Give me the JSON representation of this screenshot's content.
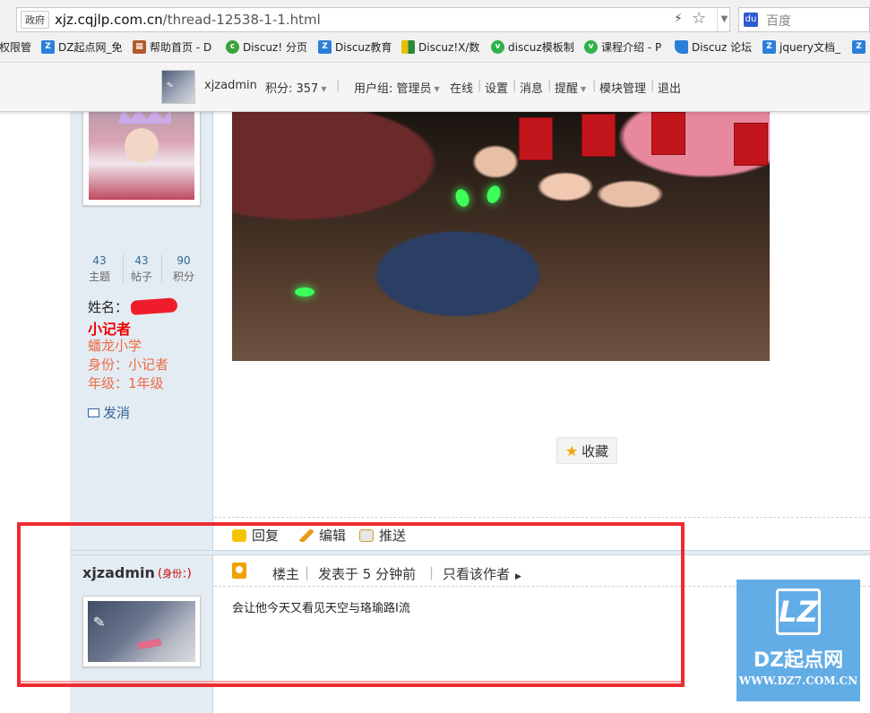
{
  "browser": {
    "address_badge": "政府",
    "url_host": "xjz.cqjlp.com.cn",
    "url_path": "/thread-12538-1-1.html",
    "search_placeholder": "百度",
    "bookmarks": [
      {
        "label": "权限管",
        "icon": "bookmark-icon",
        "color": "#888888"
      },
      {
        "label": "DZ起点网_免",
        "icon": "dz-icon",
        "color": "#2c7fd8"
      },
      {
        "label": "帮助首页 - D",
        "icon": "brick-icon",
        "color": "#b35a2a"
      },
      {
        "label": "Discuz! 分页",
        "icon": "c-icon",
        "color": "#3aa23a"
      },
      {
        "label": "Discuz教育",
        "icon": "dz-icon",
        "color": "#2c7fd8"
      },
      {
        "label": "Discuz!X/数",
        "icon": "grid-icon",
        "color": "#c8a400"
      },
      {
        "label": "discuz模板制",
        "icon": "v-icon",
        "color": "#2fb14a"
      },
      {
        "label": "课程介绍 - P",
        "icon": "v-icon",
        "color": "#2fb14a"
      },
      {
        "label": "Discuz 论坛",
        "icon": "flag-icon",
        "color": "#2c7fd8"
      },
      {
        "label": "jquery文档_",
        "icon": "dz-icon",
        "color": "#2c7fd8"
      }
    ]
  },
  "userbar": {
    "username": "xjzadmin",
    "points": "积分: 357",
    "usergroup": "用户组: 管理员",
    "links": [
      "在线",
      "设置",
      "消息",
      "提醒",
      "模块管理",
      "退出"
    ]
  },
  "post1": {
    "stats": [
      {
        "value": "43",
        "label": "主题"
      },
      {
        "value": "43",
        "label": "帖子"
      },
      {
        "value": "90",
        "label": "积分"
      }
    ],
    "name_label": "姓名：",
    "group": "小记者",
    "school": "蟠龙小学",
    "identity": "身份：小记者",
    "grade": "年级：1年级",
    "message_link": "发消",
    "collect_label": "收藏"
  },
  "actions": {
    "reply": "回复",
    "edit": "编辑",
    "push": "推送"
  },
  "post2": {
    "author": "xjzadmin",
    "role_open": "(",
    "role_label": "身份：",
    "role_close": ")",
    "floor": "楼主",
    "posted": "发表于 5 分钟前",
    "only_author": "只看该作者",
    "body": "会让他今天又看见天空与珞瑜路I流"
  },
  "watermark": {
    "logo": "LZ",
    "name": "DZ起点网",
    "url": "WWW.DZ7.COM.CN"
  },
  "colors": {
    "highlight": "#ee2b2f",
    "sidebar": "#e3ecf3",
    "group_red": "#ee0000",
    "info_orange": "#ee6b44",
    "watermark_blue": "#58a7e6"
  }
}
